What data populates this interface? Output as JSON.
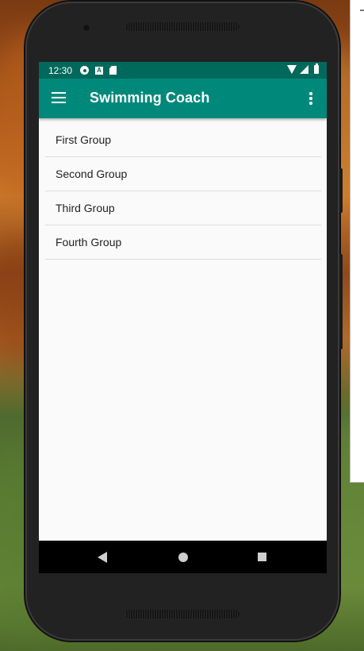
{
  "status_bar": {
    "time": "12:30",
    "left_icons": [
      "gear-icon",
      "a-icon",
      "sd-card-icon"
    ],
    "right_icons": [
      "wifi-icon",
      "signal-icon",
      "battery-icon"
    ]
  },
  "app_bar": {
    "title": "Swimming Coach",
    "menu_icon": "hamburger-menu-icon",
    "overflow_icon": "more-vertical-icon"
  },
  "groups": [
    {
      "label": "First Group"
    },
    {
      "label": "Second Group"
    },
    {
      "label": "Third Group"
    },
    {
      "label": "Fourth Group"
    }
  ],
  "nav_bar": {
    "icons": [
      "back-icon",
      "home-icon",
      "recents-icon"
    ]
  },
  "colors": {
    "status_bar": "#00695c",
    "app_bar": "#00897b",
    "background": "#fafafa"
  }
}
